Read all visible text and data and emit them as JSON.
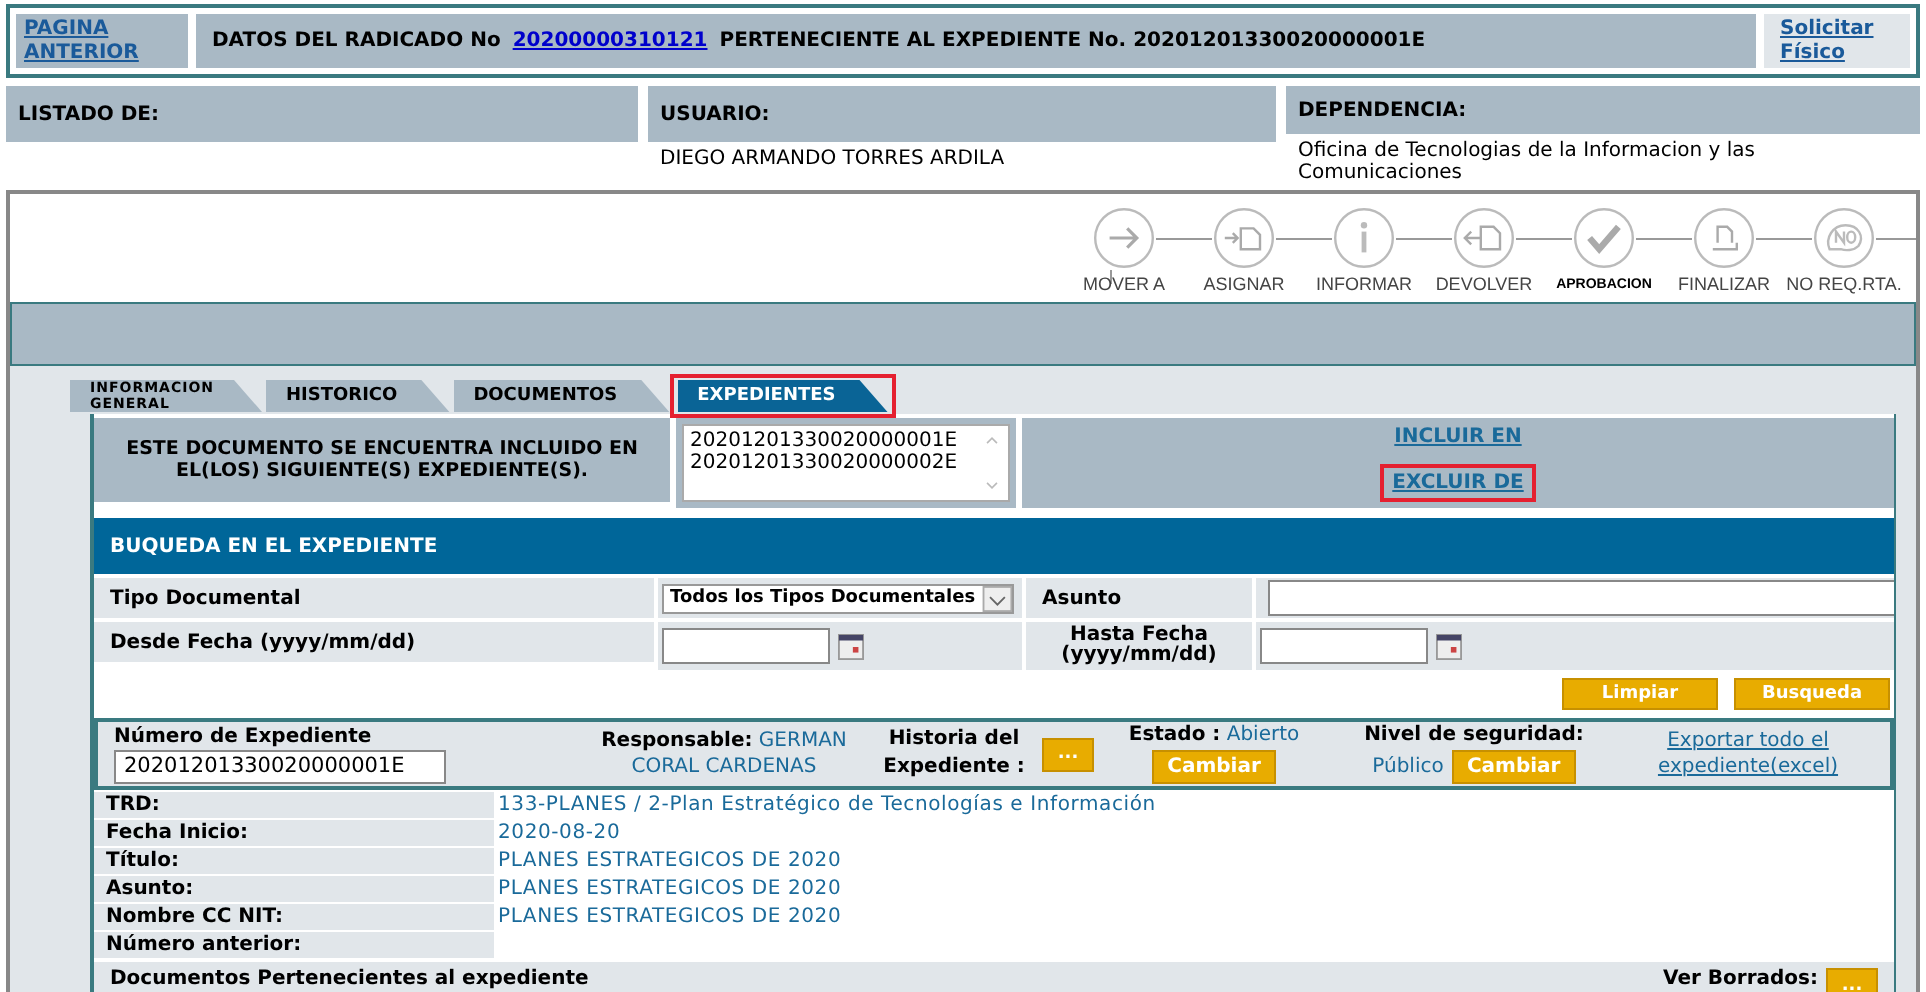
{
  "top_bar": {
    "back_link": "PAGINA ANTERIOR",
    "title_prefix": "DATOS DEL RADICADO No",
    "radicado_link": "20200000310121",
    "title_suffix": "PERTENECIENTE AL EXPEDIENTE No. 20201201330020000001E",
    "request_link": "Solicitar Físico"
  },
  "info_columns": [
    {
      "label": "LISTADO DE:"
    },
    {
      "label": "USUARIO:",
      "value": "DIEGO ARMANDO TORRES ARDILA"
    },
    {
      "label": "DEPENDENCIA:",
      "value": "Oficina de Tecnologias de la Informacion y las Comunicaciones"
    }
  ],
  "toolbar": [
    {
      "label": "MOVER A",
      "kind": "move"
    },
    {
      "label": "ASIGNAR",
      "kind": "assign"
    },
    {
      "label": "INFORMAR",
      "kind": "inform"
    },
    {
      "label": "DEVOLVER",
      "kind": "return"
    },
    {
      "label": "APROBACION",
      "kind": "approve"
    },
    {
      "label": "FINALIZAR",
      "kind": "finish"
    },
    {
      "label": "NO REQ.RTA.",
      "kind": "noreply"
    }
  ],
  "tabs": [
    {
      "label": "INFORMACION GENERAL",
      "selected": false,
      "highlighted": false
    },
    {
      "label": "HISTORICO",
      "selected": false,
      "highlighted": false
    },
    {
      "label": "DOCUMENTOS",
      "selected": false,
      "highlighted": false
    },
    {
      "label": "EXPEDIENTES",
      "selected": true,
      "highlighted": true
    }
  ],
  "inclusion": {
    "message": "ESTE DOCUMENTO SE ENCUENTRA INCLUIDO EN EL(LOS) SIGUIENTE(S) EXPEDIENTE(S).",
    "expedientes": [
      "20201201330020000001E",
      "20201201330020000002E"
    ],
    "links": [
      {
        "label": "INCLUIR EN",
        "highlighted": false
      },
      {
        "label": "EXCLUIR DE",
        "highlighted": true
      }
    ]
  },
  "search": {
    "title": "BUQUEDA EN EL EXPEDIENTE",
    "tipo_label": "Tipo Documental",
    "tipo_value": "Todos los Tipos Documentales",
    "asunto_label": "Asunto",
    "desde_label": "Desde Fecha (yyyy/mm/dd)",
    "hasta_label": "Hasta Fecha (yyyy/mm/dd)",
    "buttons": [
      "Limpiar",
      "Busqueda"
    ]
  },
  "expediente": {
    "numero_label": "Número de Expediente",
    "numero_value": "20201201330020000001E",
    "responsable_label": "Responsable:",
    "responsable_value": "GERMAN CORAL CARDENAS",
    "historia_label": "Historia del Expediente :",
    "historia_button": "...",
    "estado_label": "Estado :",
    "estado_value": "Abierto",
    "estado_button": "Cambiar",
    "nivel_label": "Nivel de seguridad:",
    "nivel_value": "Público",
    "nivel_button": "Cambiar",
    "export_link": "Exportar todo el expediente(excel)"
  },
  "details": [
    {
      "label": "TRD:",
      "value": "133-PLANES / 2-Plan Estratégico de Tecnologías e Información"
    },
    {
      "label": "Fecha Inicio:",
      "value": "2020-08-20"
    },
    {
      "label": "Título:",
      "value": "PLANES ESTRATEGICOS DE 2020"
    },
    {
      "label": "Asunto:",
      "value": "PLANES ESTRATEGICOS DE 2020"
    },
    {
      "label": "Nombre CC NIT:",
      "value": "PLANES ESTRATEGICOS DE 2020"
    },
    {
      "label": "Número anterior:"
    }
  ],
  "documents": {
    "title": "Documentos Pertenecientes al expediente",
    "deleted_label": "Ver Borrados:",
    "deleted_button": "..."
  }
}
